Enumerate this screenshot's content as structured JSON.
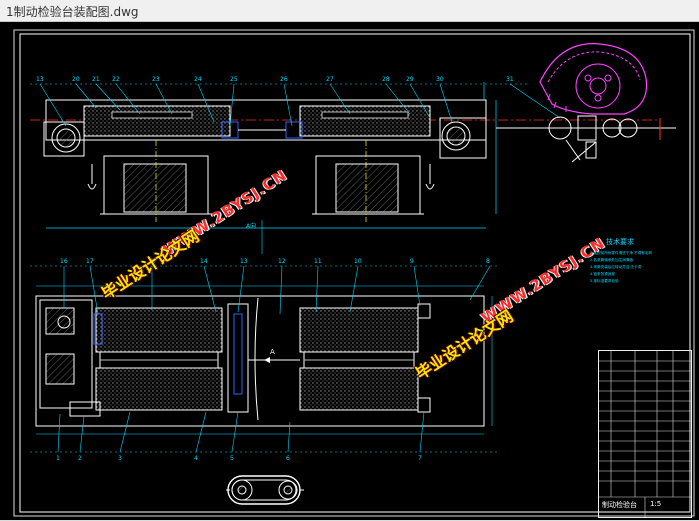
{
  "window": {
    "title": "1制动检验台装配图.dwg"
  },
  "drawing": {
    "labels": {
      "section_mark": "A向",
      "view_mark": "A",
      "top_balloons": [
        "13",
        "20",
        "21",
        "22",
        "23",
        "24",
        "25",
        "26",
        "27",
        "28",
        "29",
        "30",
        "31"
      ],
      "bottom_balloons_top": [
        "16",
        "17",
        "15",
        "14",
        "13",
        "12",
        "11",
        "10",
        "9",
        "8"
      ],
      "bottom_balloons_bottom": [
        "1",
        "2",
        "3",
        "4",
        "5",
        "6",
        "7"
      ]
    },
    "notes": {
      "title": "技术要求",
      "lines": [
        "1.装配前所有零件清洗干净,不得有毛刺",
        "2.各滚筒轴承处加注润滑脂",
        "3.滚筒安装后应转动灵活,无卡滞",
        "4.链条张紧适度",
        "5.按标准要求检验"
      ]
    },
    "title_block": {
      "name": "制动检验台",
      "scale": "1:5"
    }
  },
  "watermark": {
    "cn": "毕业设计论文网",
    "url": "WWW.2BYSJ.CN"
  },
  "colors": {
    "background": "#000000",
    "outline": "#ffffff",
    "dimension": "#00d8ff",
    "hidden": "#ff3030",
    "center": "#ffff00",
    "gear": "#ff40ff",
    "hatch": "#9a9a9a",
    "blue": "#3060ff"
  }
}
